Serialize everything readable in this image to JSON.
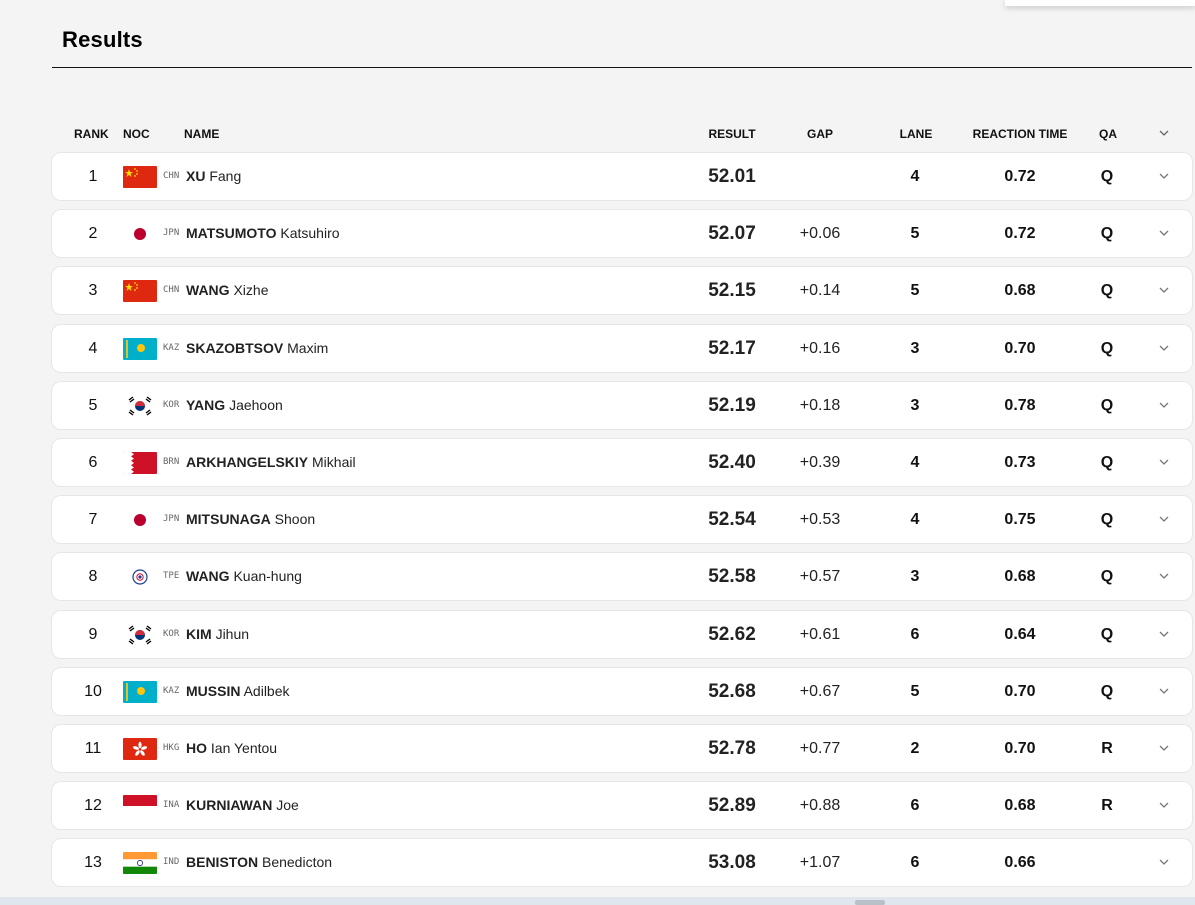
{
  "page": {
    "title": "Results"
  },
  "table": {
    "headers": {
      "rank": "RANK",
      "noc": "NOC",
      "name": "NAME",
      "result": "RESULT",
      "gap": "GAP",
      "lane": "LANE",
      "reaction_time": "REACTION TIME",
      "qa": "QA"
    },
    "rows": [
      {
        "rank": "1",
        "flag": "CHN",
        "noc": "CHN",
        "last": "XU",
        "first": "Fang",
        "result": "52.01",
        "gap": "",
        "lane": "4",
        "reaction": "0.72",
        "qa": "Q"
      },
      {
        "rank": "2",
        "flag": "JPN",
        "noc": "JPN",
        "last": "MATSUMOTO",
        "first": "Katsuhiro",
        "result": "52.07",
        "gap": "+0.06",
        "lane": "5",
        "reaction": "0.72",
        "qa": "Q"
      },
      {
        "rank": "3",
        "flag": "CHN",
        "noc": "CHN",
        "last": "WANG",
        "first": "Xizhe",
        "result": "52.15",
        "gap": "+0.14",
        "lane": "5",
        "reaction": "0.68",
        "qa": "Q"
      },
      {
        "rank": "4",
        "flag": "KAZ",
        "noc": "KAZ",
        "last": "SKAZOBTSOV",
        "first": "Maxim",
        "result": "52.17",
        "gap": "+0.16",
        "lane": "3",
        "reaction": "0.70",
        "qa": "Q"
      },
      {
        "rank": "5",
        "flag": "KOR",
        "noc": "KOR",
        "last": "YANG",
        "first": "Jaehoon",
        "result": "52.19",
        "gap": "+0.18",
        "lane": "3",
        "reaction": "0.78",
        "qa": "Q"
      },
      {
        "rank": "6",
        "flag": "BRN",
        "noc": "BRN",
        "last": "ARKHANGELSKIY",
        "first": "Mikhail",
        "result": "52.40",
        "gap": "+0.39",
        "lane": "4",
        "reaction": "0.73",
        "qa": "Q"
      },
      {
        "rank": "7",
        "flag": "JPN",
        "noc": "JPN",
        "last": "MITSUNAGA",
        "first": "Shoon",
        "result": "52.54",
        "gap": "+0.53",
        "lane": "4",
        "reaction": "0.75",
        "qa": "Q"
      },
      {
        "rank": "8",
        "flag": "TPE",
        "noc": "TPE",
        "last": "WANG",
        "first": "Kuan-hung",
        "result": "52.58",
        "gap": "+0.57",
        "lane": "3",
        "reaction": "0.68",
        "qa": "Q"
      },
      {
        "rank": "9",
        "flag": "KOR",
        "noc": "KOR",
        "last": "KIM",
        "first": "Jihun",
        "result": "52.62",
        "gap": "+0.61",
        "lane": "6",
        "reaction": "0.64",
        "qa": "Q"
      },
      {
        "rank": "10",
        "flag": "KAZ",
        "noc": "KAZ",
        "last": "MUSSIN",
        "first": "Adilbek",
        "result": "52.68",
        "gap": "+0.67",
        "lane": "5",
        "reaction": "0.70",
        "qa": "Q"
      },
      {
        "rank": "11",
        "flag": "HKG",
        "noc": "HKG",
        "last": "HO",
        "first": "Ian Yentou",
        "result": "52.78",
        "gap": "+0.77",
        "lane": "2",
        "reaction": "0.70",
        "qa": "R"
      },
      {
        "rank": "12",
        "flag": "INA",
        "noc": "INA",
        "last": "KURNIAWAN",
        "first": "Joe",
        "result": "52.89",
        "gap": "+0.88",
        "lane": "6",
        "reaction": "0.68",
        "qa": "R"
      },
      {
        "rank": "13",
        "flag": "IND",
        "noc": "IND",
        "last": "BENISTON",
        "first": "Benedicton",
        "result": "53.08",
        "gap": "+1.07",
        "lane": "6",
        "reaction": "0.66",
        "qa": ""
      }
    ]
  },
  "colors": {
    "background": "#f4f4f4",
    "row_background": "#ffffff",
    "text": "#222222"
  }
}
